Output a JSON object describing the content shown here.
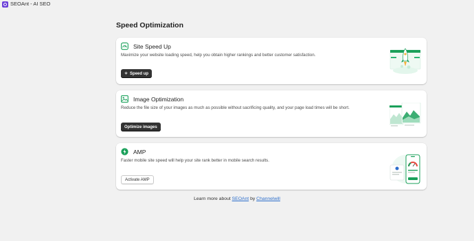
{
  "app": {
    "title": "SEOAnt - AI SEO"
  },
  "page": {
    "title": "Speed Optimization"
  },
  "cards": [
    {
      "title": "Site Speed Up",
      "icon": "speedometer-icon",
      "description": "Maximize your website loading speed, help you obtain higher rankings and better customer satisfaction.",
      "button_label": "Speed up",
      "button_icon": "bolt-icon"
    },
    {
      "title": "Image Optimization",
      "icon": "image-icon",
      "description": "Reduce the file size of your images as much as possible without sacrificing quality, and your page load times will be short.",
      "button_label": "Optimize images"
    },
    {
      "title": "AMP",
      "icon": "amp-bolt-icon",
      "description": "Faster mobile site speed will help your site rank better in mobile search results.",
      "button_label": "Activate AMP"
    }
  ],
  "footer": {
    "prefix": "Learn more about",
    "link1": "SEOAnt",
    "middle": "by",
    "link2": "Channelwill"
  },
  "colors": {
    "accent_green": "#1aa05a",
    "dark_button": "#333333",
    "link": "#2c6ecb",
    "app_icon": "#6b3fd8"
  }
}
